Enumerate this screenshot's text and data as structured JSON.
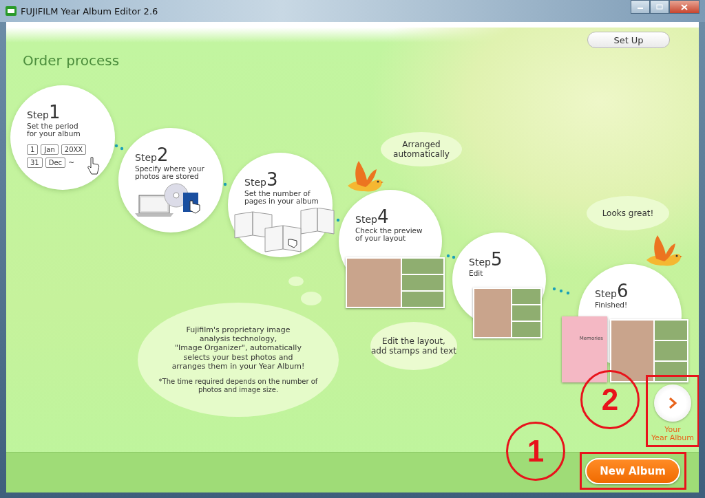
{
  "window": {
    "title": "FUJIFILM Year Album Editor 2.6"
  },
  "setup_button": "Set Up",
  "heading": "Order process",
  "steps": [
    {
      "label": "Step",
      "number": "1",
      "text": "Set the period\nfor your album",
      "date_rows": [
        [
          "1",
          "Jan",
          "20XX"
        ],
        [
          "31",
          "Dec"
        ]
      ],
      "range_sign": "~"
    },
    {
      "label": "Step",
      "number": "2",
      "text": "Specify where your\nphotos are stored"
    },
    {
      "label": "Step",
      "number": "3",
      "text": "Set the number of\npages in your album"
    },
    {
      "label": "Step",
      "number": "4",
      "text": "Check the preview\nof your layout"
    },
    {
      "label": "Step",
      "number": "5",
      "text": "Edit"
    },
    {
      "label": "Step",
      "number": "6",
      "text": "Finished!",
      "album_title": "Memories"
    }
  ],
  "bubbles": [
    {
      "kind": "speech",
      "text": "Arranged\nautomatically"
    },
    {
      "kind": "speech",
      "text": "Looks great!"
    },
    {
      "kind": "thought",
      "text": "Fujifilm's proprietary image\nanalysis technology,\n\"Image Organizer\", automatically\nselects your best photos and\narranges them in your Year Album!",
      "note": "*The time required depends on the number of\nphotos and image size."
    },
    {
      "kind": "speech",
      "text": "Edit the layout,\nadd stamps and text"
    }
  ],
  "next_button": {
    "label": "Your\nYear Album"
  },
  "new_album_button": "New Album",
  "annotations": [
    {
      "number": "1"
    },
    {
      "number": "2"
    }
  ]
}
